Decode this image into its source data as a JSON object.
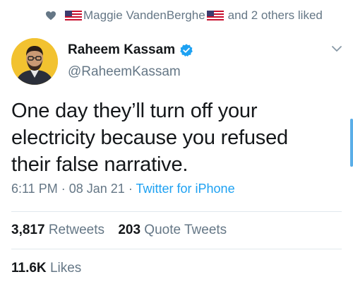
{
  "social_context": {
    "liker_name": "Maggie VandenBerghe",
    "others_text": "and 2 others liked"
  },
  "tweet": {
    "author_name": "Raheem Kassam",
    "author_handle": "@RaheemKassam",
    "text": "One day they’ll turn off your electricity because you refused their false narrative.",
    "time": "6:11 PM",
    "date": "08 Jan 21",
    "source": "Twitter for iPhone",
    "separator": "·"
  },
  "stats": {
    "retweets_count": "3,817",
    "retweets_label": "Retweets",
    "quote_tweets_count": "203",
    "quote_tweets_label": "Quote Tweets",
    "likes_count": "11.6K",
    "likes_label": "Likes"
  },
  "colors": {
    "link": "#1da1f2",
    "secondary_text": "#657786",
    "verified": "#1da1f2",
    "avatar_bg": "#f2c230"
  },
  "icons": {
    "like": "heart-icon",
    "flag": "us-flag-icon",
    "verified": "verified-badge-icon",
    "more": "chevron-down-icon"
  }
}
